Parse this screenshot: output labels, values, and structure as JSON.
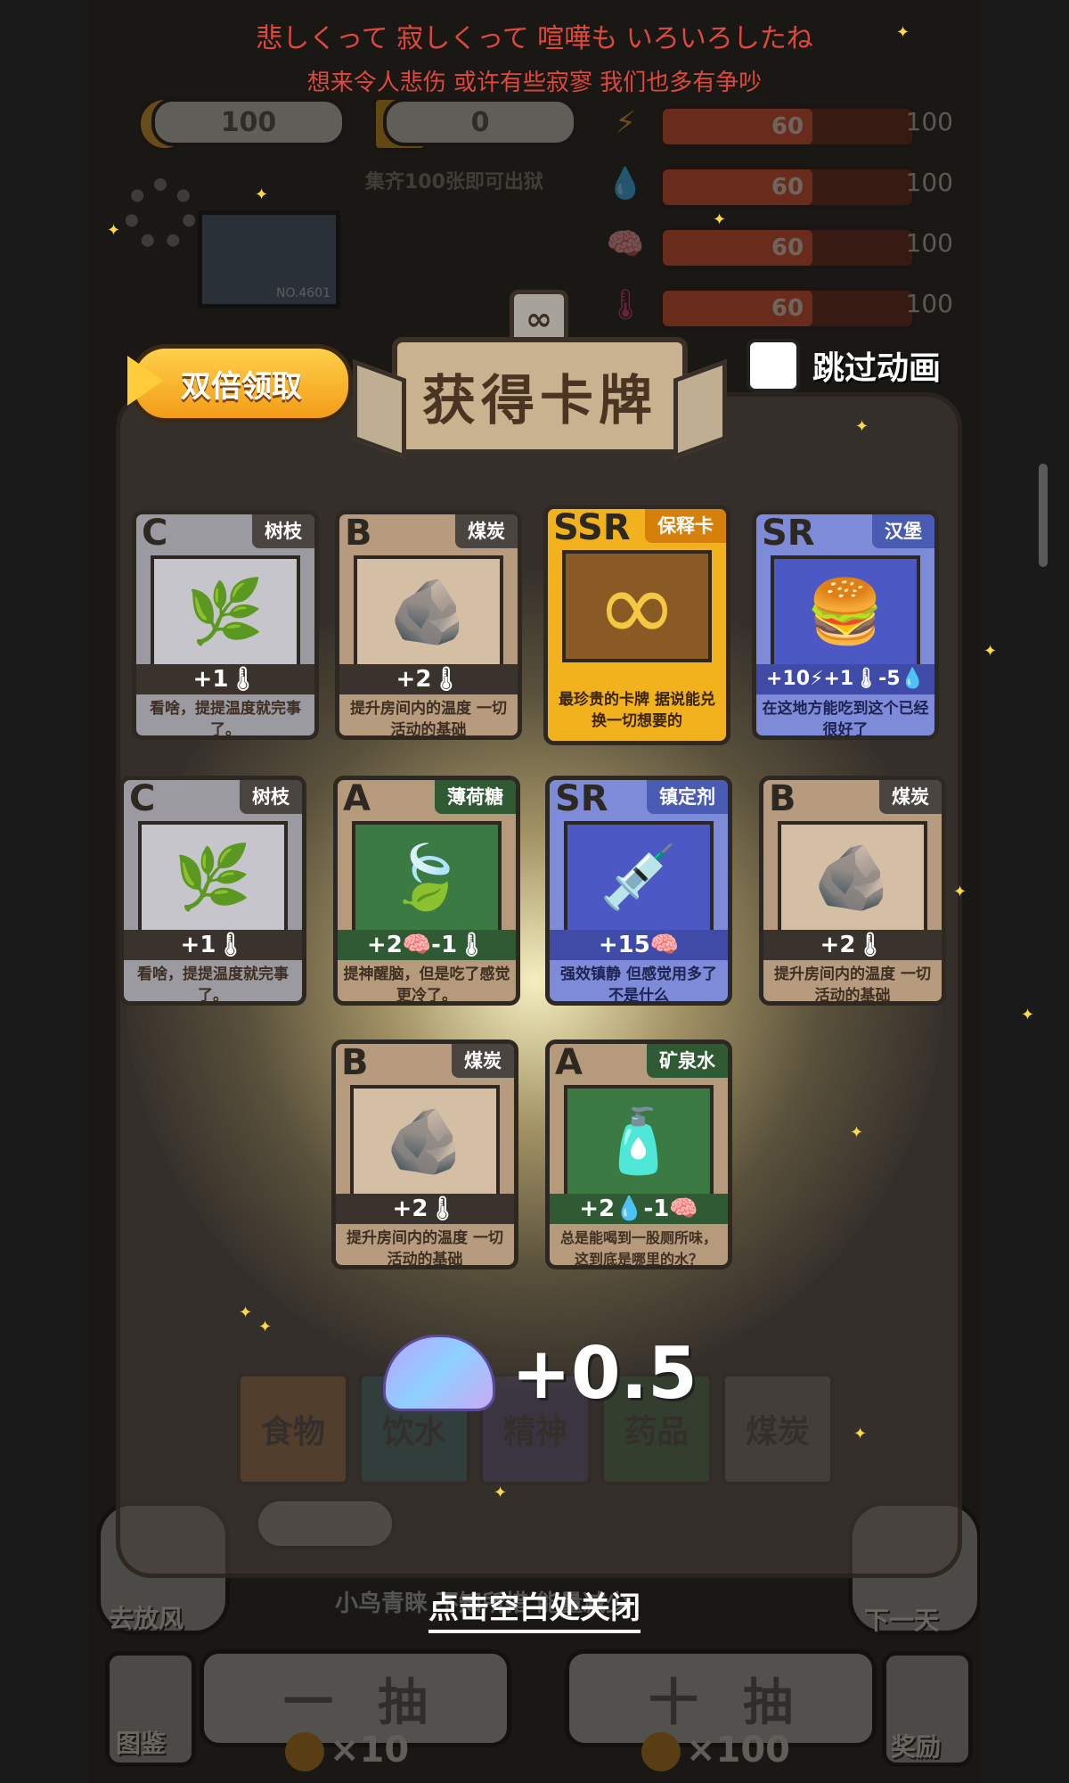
{
  "subtitles": {
    "jp": "悲しくって 寂しくって 喧嘩も いろいろしたね",
    "cn": "想来令人悲伤  或许有些寂寥  我们也多有争吵"
  },
  "hud": {
    "coin_label": "币",
    "coins": "100",
    "s_label": "S",
    "s_value": "0",
    "collect_note": "集齐100张即可出狱",
    "stats": [
      {
        "icon": "⚡",
        "name": "energy",
        "value": "60",
        "max": "100",
        "color": "#f0a93a"
      },
      {
        "icon": "💧",
        "name": "water",
        "value": "60",
        "max": "100",
        "color": "#4aa7e8"
      },
      {
        "icon": "🧠",
        "name": "mind",
        "value": "60",
        "max": "100",
        "color": "#8f7ae0"
      },
      {
        "icon": "🌡",
        "name": "temperature",
        "value": "60",
        "max": "100",
        "color": "#e0508a"
      }
    ],
    "stat_fraction": 0.6
  },
  "modal": {
    "title": "获得卡牌",
    "inf_badge": "∞",
    "double_button": "双倍领取",
    "skip_label": "跳过动画",
    "reward_amount": "+0.5",
    "close_hint": "点击空白处关闭"
  },
  "cards": [
    {
      "rarity": "C",
      "tag": "树枝",
      "stat": "+1🌡",
      "desc": "看啥，提提温度就完事了。",
      "art": "🌿",
      "class": "c"
    },
    {
      "rarity": "B",
      "tag": "煤炭",
      "stat": "+2🌡",
      "desc": "提升房间内的温度 一切活动的基础",
      "art": "🪨",
      "class": "b"
    },
    {
      "rarity": "SSR",
      "tag": "保释卡",
      "stat": "",
      "desc": "最珍贵的卡牌 据说能兑换一切想要的",
      "art": "∞",
      "class": "ssr"
    },
    {
      "rarity": "SR",
      "tag": "汉堡",
      "stat": "+10⚡+1🌡-5💧",
      "desc": "在这地方能吃到这个已经很好了",
      "art": "🍔",
      "class": "sr"
    },
    {
      "rarity": "C",
      "tag": "树枝",
      "stat": "+1🌡",
      "desc": "看啥，提提温度就完事了。",
      "art": "🌿",
      "class": "c"
    },
    {
      "rarity": "A",
      "tag": "薄荷糖",
      "stat": "+2🧠-1🌡",
      "desc": "提神醒脑，但是吃了感觉更冷了。",
      "art": "🍃",
      "class": "a"
    },
    {
      "rarity": "SR",
      "tag": "镇定剂",
      "stat": "+15🧠",
      "desc": "强效镇静 但感觉用多了不是什么",
      "art": "💉",
      "class": "sr"
    },
    {
      "rarity": "B",
      "tag": "煤炭",
      "stat": "+2🌡",
      "desc": "提升房间内的温度 一切活动的基础",
      "art": "🪨",
      "class": "b"
    },
    {
      "rarity": "B",
      "tag": "煤炭",
      "stat": "+2🌡",
      "desc": "提升房间内的温度 一切活动的基础",
      "art": "🪨",
      "class": "b"
    },
    {
      "rarity": "A",
      "tag": "矿泉水",
      "stat": "+2💧-1🧠",
      "desc": "总是能喝到一股厕所味，这到底是哪里的水？",
      "art": "🧴",
      "class": "a"
    }
  ],
  "background": {
    "tabs": [
      "食物",
      "饮水",
      "精神",
      "药品",
      "煤炭"
    ],
    "tab_colors": [
      "#d9883a",
      "#2f8a96",
      "#5e55a8",
      "#3a8a4a",
      "#8c8a86"
    ],
    "bird_message": "小鸟青睐 不知所措 能量减少",
    "left_button": "去放风",
    "right_button": "下一天",
    "guide_button": "图鉴",
    "reward_button": "奖励",
    "draw_one": "一抽",
    "draw_ten": "十抽",
    "draw_one_cost": "×10",
    "draw_ten_cost": "×100",
    "portrait_id": "NO.4601"
  }
}
